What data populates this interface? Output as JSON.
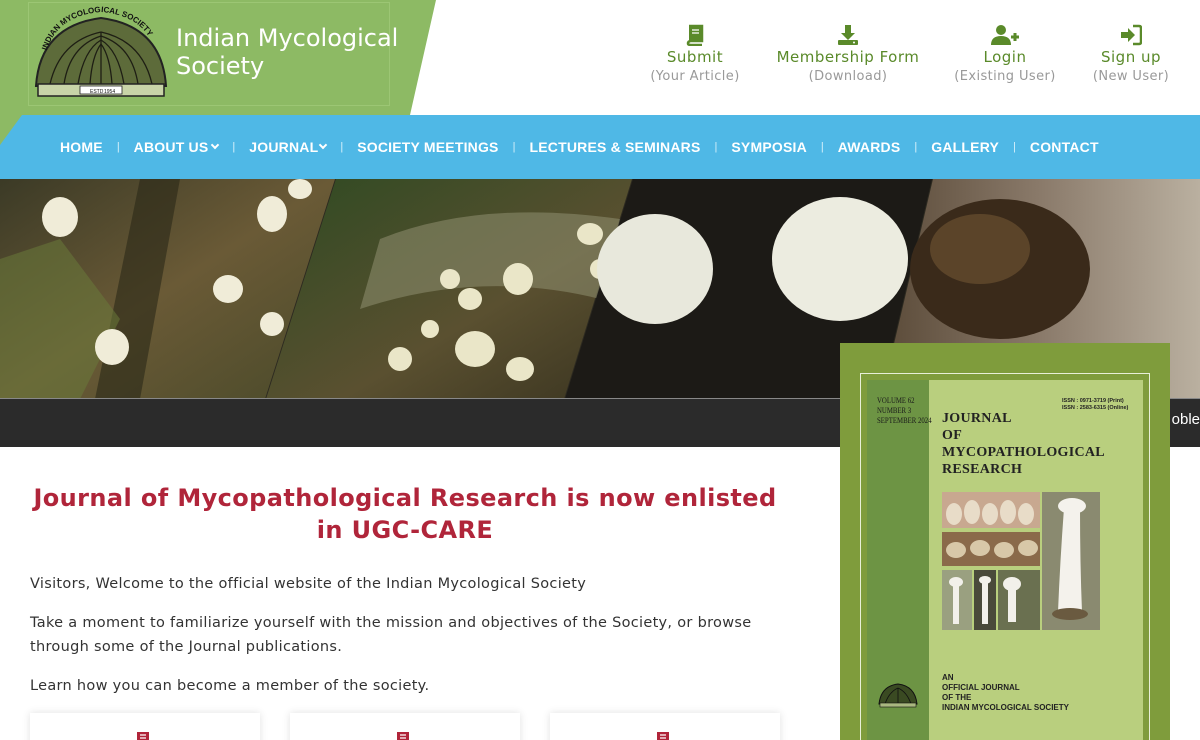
{
  "site": {
    "title_line1": "Indian Mycological",
    "title_line2": "Society",
    "emblem_text": "INDIAN MYCOLOGICAL SOCIETY",
    "emblem_estd": "ESTD",
    "emblem_year": "1954"
  },
  "quick_links": [
    {
      "label": "Submit",
      "sub": "(Your Article)",
      "icon": "book-icon"
    },
    {
      "label": "Membership Form",
      "sub": "(Download)",
      "icon": "download-icon"
    },
    {
      "label": "Login",
      "sub": "(Existing User)",
      "icon": "user-plus-icon"
    },
    {
      "label": "Sign up",
      "sub": "(New User)",
      "icon": "sign-in-icon"
    }
  ],
  "nav": {
    "home": "HOME",
    "about": "ABOUT US",
    "journal": "JOURNAL",
    "meetings": "SOCIETY MEETINGS",
    "lectures": "LECTURES & SEMINARS",
    "symposia": "SYMPOSIA",
    "awards": "AWARDS",
    "gallery": "GALLERY",
    "contact": "CONTACT",
    "separator": "|"
  },
  "ticker": {
    "text": "oble"
  },
  "main": {
    "headline": "Journal of Mycopathological Research is now enlisted in UGC-CARE",
    "p1": "Visitors, Welcome to the official website of the Indian Mycological Society",
    "p2": "Take a moment to familiarize yourself with the mission and objectives of the Society, or browse through some of the Journal publications.",
    "p3": "Learn how you can become a member of the society."
  },
  "cover": {
    "vol": "VOLUME 62",
    "num": "NUMBER 3",
    "date": "SEPTEMBER 2024",
    "issn_print": "ISSN : 0971-3719 (Print)",
    "issn_online": "ISSN : 2583-6315 (Online)",
    "t1": "JOURNAL",
    "t2": "OF",
    "t3": "MYCOPATHOLOGICAL",
    "t4": "RESEARCH",
    "f1": "AN",
    "f2": "OFFICIAL JOURNAL",
    "f3": "OF THE",
    "f4": "INDIAN MYCOLOGICAL SOCIETY"
  },
  "colors": {
    "green": "#8dba64",
    "nav_blue": "#4fb8e6",
    "headline_red": "#b0253a",
    "link_green": "#5a8a2a"
  }
}
